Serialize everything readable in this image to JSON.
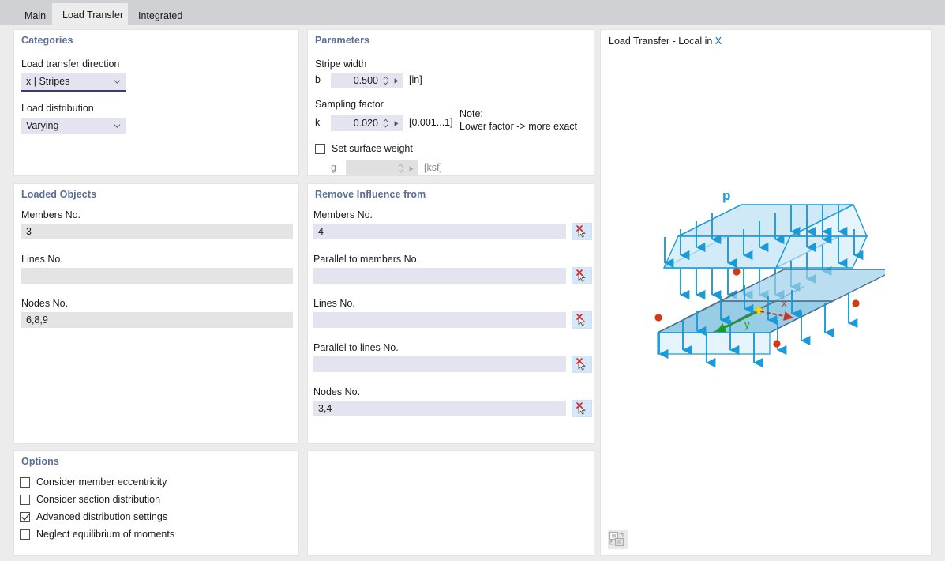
{
  "window": {
    "bg_color": "#d0d1d5",
    "client_bg": "#ececec"
  },
  "tabs": [
    {
      "label": "Main",
      "active": false
    },
    {
      "label": "Load Transfer",
      "active": true
    },
    {
      "label": "Integrated",
      "active": false
    }
  ],
  "categories": {
    "title": "Categories",
    "direction_label": "Load transfer direction",
    "direction_value": "x | Stripes",
    "distribution_label": "Load distribution",
    "distribution_value": "Varying"
  },
  "parameters": {
    "title": "Parameters",
    "stripe_width_label": "Stripe width",
    "b_symbol": "b",
    "b_value": "0.500",
    "b_unit": "[in]",
    "sampling_factor_label": "Sampling factor",
    "k_symbol": "k",
    "k_value": "0.020",
    "k_range": "[0.001...1]",
    "note_line1": "Note:",
    "note_line2": "Lower factor -> more exact",
    "set_surface_weight_label": "Set surface weight",
    "set_surface_weight_checked": false,
    "g_symbol": "g",
    "g_value": "",
    "g_unit": "[ksf]"
  },
  "loaded_objects": {
    "title": "Loaded Objects",
    "fields": [
      {
        "label": "Members No.",
        "value": "3"
      },
      {
        "label": "Lines No.",
        "value": ""
      },
      {
        "label": "Nodes No.",
        "value": "6,8,9"
      }
    ]
  },
  "remove_influence": {
    "title": "Remove Influence from",
    "fields": [
      {
        "label": "Members No.",
        "value": "4"
      },
      {
        "label": "Parallel to members No.",
        "value": ""
      },
      {
        "label": "Lines No.",
        "value": ""
      },
      {
        "label": "Parallel to lines No.",
        "value": ""
      },
      {
        "label": "Nodes No.",
        "value": "3,4"
      }
    ]
  },
  "options": {
    "title": "Options",
    "items": [
      {
        "label": "Consider member eccentricity",
        "checked": false
      },
      {
        "label": "Consider section distribution",
        "checked": false
      },
      {
        "label": "Advanced distribution settings",
        "checked": true
      },
      {
        "label": "Neglect equilibrium of moments",
        "checked": false
      }
    ]
  },
  "graphics": {
    "title_prefix": "Load Transfer - Local in ",
    "title_axis": "X",
    "load_label": "p",
    "axis_x_label": "x",
    "axis_y_label": "y",
    "toolbar_icon": "swap-images-icon"
  },
  "colors": {
    "panel_header": "#5a6e96",
    "accent_blue": "#0a6fc2",
    "field_lavender": "#e3e4ef",
    "field_grey": "#e4e4e4",
    "focus_underline": "#3b3b70",
    "pick_button": "#d6e7f7"
  }
}
